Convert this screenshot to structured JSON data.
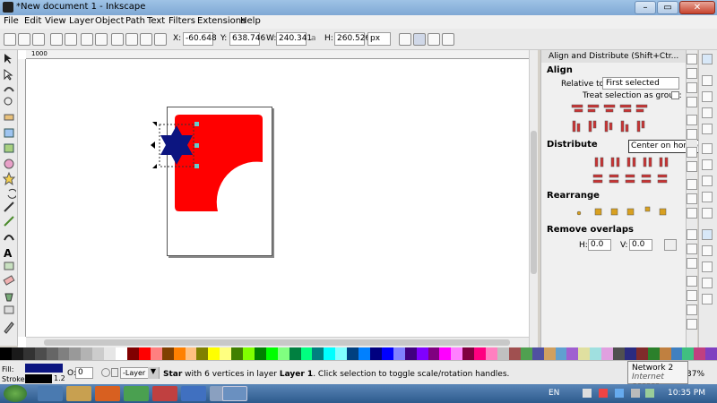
{
  "window": {
    "title": "*New document 1 - Inkscape"
  },
  "menu": [
    "File",
    "Edit",
    "View",
    "Layer",
    "Object",
    "Path",
    "Text",
    "Filters",
    "Extensions",
    "Help"
  ],
  "toolbar": {
    "x_label": "X:",
    "x_value": "-60.648",
    "y_label": "Y:",
    "y_value": "638.746",
    "w_label": "W:",
    "w_value": "240.341",
    "h_label": "H:",
    "h_value": "260.526",
    "unit": "px"
  },
  "ruler": {
    "h_tick": "1000"
  },
  "panel": {
    "title": "Align and Distribute (Shift+Ctr...",
    "align_heading": "Align",
    "relative_label": "Relative to:",
    "relative_value": "First selected",
    "treat_group_label": "Treat selection as group:",
    "distribute_heading": "Distribute",
    "rearrange_heading": "Rearrange",
    "remove_overlaps_heading": "Remove overlaps",
    "h_label": "H:",
    "h_value": "0.0",
    "v_label": "V:",
    "v_value": "0.0"
  },
  "tooltip": "Center on horizontal axis",
  "status": {
    "fill_label": "Fill:",
    "stroke_label": "Stroke:",
    "stroke_width": "1.2",
    "opacity_label": "O:",
    "opacity_value": "0",
    "layer": "-Layer 1",
    "message_pre": "Star",
    "message_mid": " with 6 vertices in layer ",
    "message_layer": "Layer 1",
    "message_post": ". Click selection to toggle scale/rotation handles.",
    "zoom": "37%"
  },
  "network_popup": {
    "name": "Network  2",
    "status": "Internet access"
  },
  "taskbar": {
    "lang": "EN",
    "time": "10:35 PM"
  },
  "colors": {
    "fill": "#0c1580",
    "stroke": "#000000",
    "red_shape": "#ff0000",
    "star": "#0c1580"
  }
}
